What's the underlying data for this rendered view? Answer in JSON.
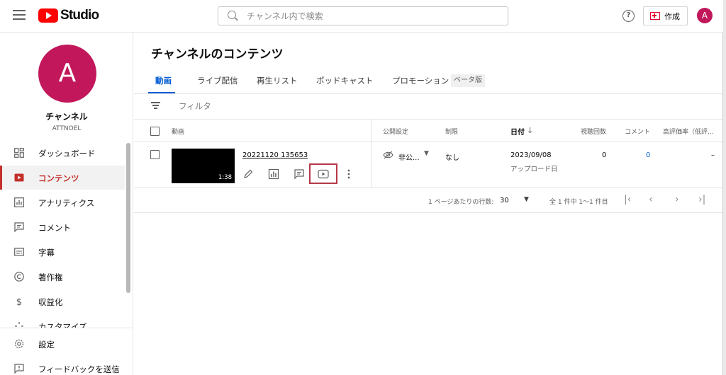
{
  "header": {
    "logo_text": "Studio",
    "search_placeholder": "チャンネル内で検索",
    "help_label": "?",
    "create_label": "作成",
    "avatar_initial": "A"
  },
  "sidebar": {
    "avatar_initial": "A",
    "channel_title": "チャンネル",
    "channel_handle": "ATTNOEL",
    "items": [
      {
        "label": "ダッシュボード",
        "icon": "dashboard-icon"
      },
      {
        "label": "コンテンツ",
        "icon": "content-icon",
        "active": true
      },
      {
        "label": "アナリティクス",
        "icon": "analytics-icon"
      },
      {
        "label": "コメント",
        "icon": "comment-icon"
      },
      {
        "label": "字幕",
        "icon": "subtitles-icon"
      },
      {
        "label": "著作権",
        "icon": "copyright-icon"
      },
      {
        "label": "収益化",
        "icon": "dollar-icon"
      },
      {
        "label": "カスタマイズ",
        "icon": "customize-icon"
      }
    ],
    "bottom_items": [
      {
        "label": "設定",
        "icon": "settings-icon"
      },
      {
        "label": "フィードバックを送信",
        "icon": "feedback-icon"
      }
    ]
  },
  "main": {
    "title": "チャンネルのコンテンツ",
    "tabs": [
      "動画",
      "ライブ配信",
      "再生リスト",
      "ポッドキャスト",
      "プロモーション"
    ],
    "beta_badge": "ベータ版",
    "filter_label": "フィルタ",
    "columns": {
      "video": "動画",
      "visibility": "公開設定",
      "restrictions": "制限",
      "date": "日付",
      "views": "視聴回数",
      "comments": "コメント",
      "likes": "高評価率（低評..."
    },
    "row": {
      "title": "20221120 135653",
      "duration": "1:38",
      "visibility": "非公...",
      "restrictions": "なし",
      "date": "2023/09/08",
      "date_sub": "アップロード日",
      "views": "0",
      "comments": "0",
      "likes": "–"
    },
    "pagination": {
      "rows_label": "1 ページあたりの行数:",
      "rows_value": "30",
      "range_label": "全 1 件中 1～1 件目"
    }
  },
  "colors": {
    "brand_red": "#ff0000",
    "active_red": "#c4302b",
    "link_blue": "#065fd4",
    "avatar": "#c2185b",
    "highlight_box": "#b5394b"
  }
}
